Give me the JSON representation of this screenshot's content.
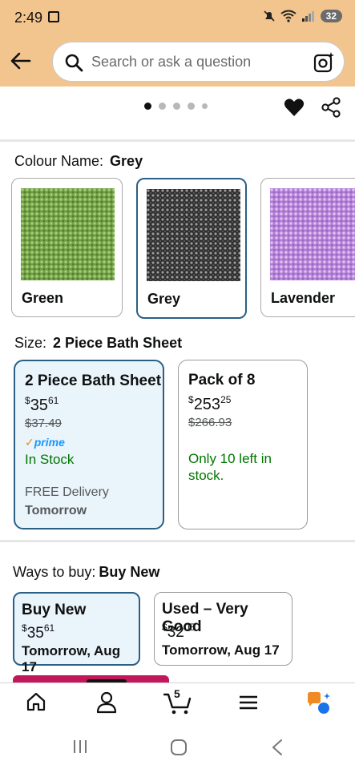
{
  "status": {
    "time": "2:49",
    "battery": "32"
  },
  "search": {
    "placeholder": "Search or ask a question"
  },
  "colour": {
    "label": "Colour Name:",
    "selected": "Grey",
    "options": [
      {
        "name": "Green",
        "color": "#7fae54"
      },
      {
        "name": "Grey",
        "color": "#3b3b3b"
      },
      {
        "name": "Lavender",
        "color": "#c79ae6"
      }
    ]
  },
  "size": {
    "label": "Size:",
    "selected": "2 Piece Bath Sheet",
    "options": [
      {
        "title": "2 Piece Bath Sheet",
        "price_symbol": "$",
        "price_whole": "35",
        "price_frac": "61",
        "list_price": "$37.49",
        "prime": "prime",
        "stock": "In Stock",
        "delivery_label": "FREE Delivery",
        "delivery_day": "Tomorrow"
      },
      {
        "title": "Pack of 8",
        "price_symbol": "$",
        "price_whole": "253",
        "price_frac": "25",
        "list_price": "$266.93",
        "stock": "Only 10 left in stock."
      }
    ]
  },
  "ways": {
    "label": "Ways to buy:",
    "selected": "Buy New",
    "options": [
      {
        "title": "Buy New",
        "price_symbol": "$",
        "price_whole": "35",
        "price_frac": "61",
        "date": "Tomorrow, Aug 17"
      },
      {
        "title": "Used – Very Good",
        "price_symbol": "$",
        "price_whole": "32",
        "price_frac": "05",
        "date": "Tomorrow, Aug 17"
      }
    ]
  },
  "nav": {
    "cart_count": "5"
  },
  "colors": {
    "header": "#f3c58e",
    "selected_border": "#2a5f86",
    "in_stock": "#007600",
    "prime": "#1a98ff"
  }
}
